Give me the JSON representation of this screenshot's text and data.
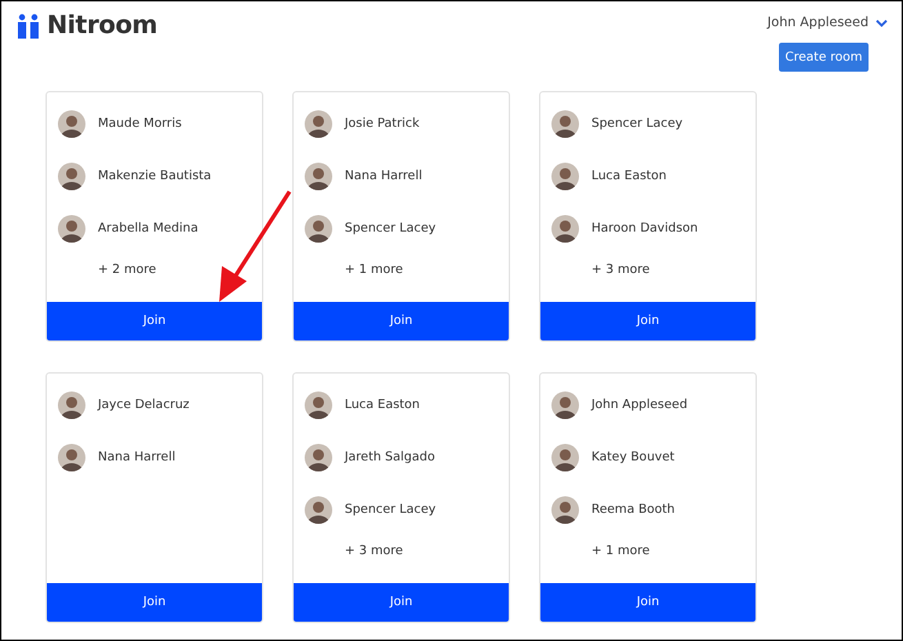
{
  "brand": {
    "name": "Nitroom"
  },
  "user_menu": {
    "label": "John Appleseed"
  },
  "create_button": {
    "label": "Create room"
  },
  "rooms": [
    {
      "members": [
        "Maude Morris",
        "Makenzie Bautista",
        "Arabella Medina"
      ],
      "more": "+ 2 more",
      "join": "Join"
    },
    {
      "members": [
        "Josie Patrick",
        "Nana Harrell",
        "Spencer Lacey"
      ],
      "more": "+ 1 more",
      "join": "Join"
    },
    {
      "members": [
        "Spencer Lacey",
        "Luca Easton",
        "Haroon Davidson"
      ],
      "more": "+ 3 more",
      "join": "Join"
    },
    {
      "members": [
        "Jayce Delacruz",
        "Nana Harrell"
      ],
      "join": "Join"
    },
    {
      "members": [
        "Luca Easton",
        "Jareth Salgado",
        "Spencer Lacey"
      ],
      "more": "+ 3 more",
      "join": "Join"
    },
    {
      "members": [
        "John Appleseed",
        "Katey Bouvet",
        "Reema Booth"
      ],
      "more": "+ 1 more",
      "join": "Join"
    }
  ]
}
